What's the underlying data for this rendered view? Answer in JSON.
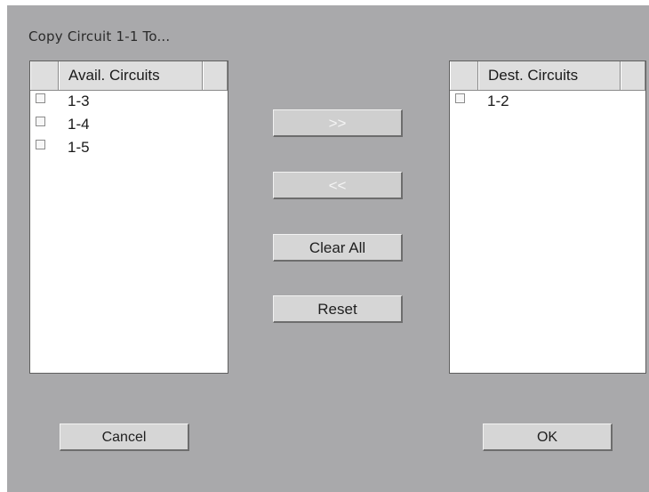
{
  "dialog": {
    "title": "Copy Circuit 1-1 To..."
  },
  "available": {
    "header": "Avail. Circuits",
    "items": [
      {
        "label": "1-3",
        "checked": false
      },
      {
        "label": "1-4",
        "checked": false
      },
      {
        "label": "1-5",
        "checked": false
      }
    ]
  },
  "destination": {
    "header": "Dest. Circuits",
    "items": [
      {
        "label": "1-2",
        "checked": false
      }
    ]
  },
  "buttons": {
    "move_right": ">>",
    "move_left": "<<",
    "clear_all": "Clear All",
    "reset": "Reset",
    "cancel": "Cancel",
    "ok": "OK"
  },
  "colors": {
    "dialog_background": "#a9a9ab",
    "list_background": "#ffffff",
    "button_face": "#d6d6d6"
  }
}
